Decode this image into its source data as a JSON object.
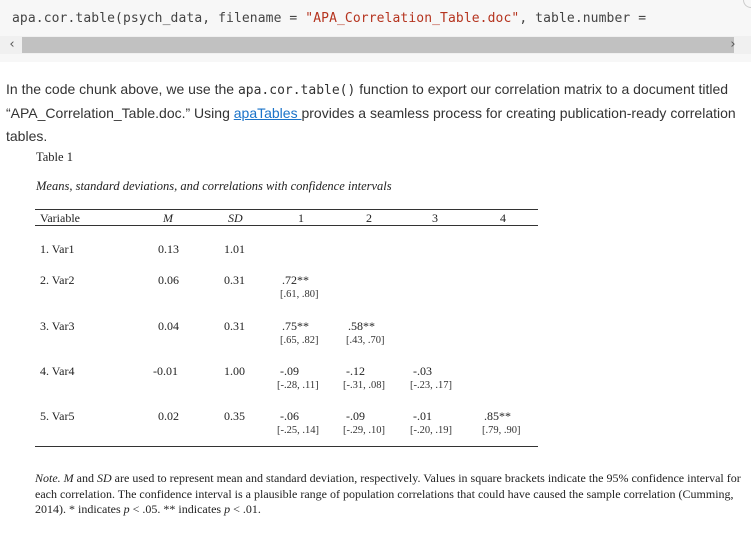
{
  "code": {
    "fn_part": "apa.cor.table(psych_data, filename = ",
    "string_part": "\"APA_Correlation_Table.doc\"",
    "rest_part": ", table.number ="
  },
  "scroll": {
    "left_arrow": "‹",
    "right_arrow": "›"
  },
  "paragraph": {
    "line1_before": "In the code chunk above, we use the ",
    "line1_code": "apa.cor.table()",
    "line1_after": " function to export our correlation matrix to a document titled",
    "line2_before": "“APA_Correlation_Table.doc.” Using ",
    "link_text": "apaTables ",
    "line2_after": "provides a seamless process for creating publication-ready correlation tables."
  },
  "apa_table": {
    "table_number": "Table 1",
    "title": "Means, standard deviations, and correlations with confidence intervals",
    "headers": [
      "Variable",
      "M",
      "SD",
      "1",
      "2",
      "3",
      "4"
    ],
    "rows": [
      {
        "variable": "1. Var1",
        "m": "0.13",
        "sd": "1.01",
        "corr": []
      },
      {
        "variable": "2. Var2",
        "m": "0.06",
        "sd": "0.31",
        "corr": [
          {
            "r": ".72**",
            "ci": "[.61, .80]"
          }
        ]
      },
      {
        "variable": "3. Var3",
        "m": "0.04",
        "sd": "0.31",
        "corr": [
          {
            "r": ".75**",
            "ci": "[.65, .82]"
          },
          {
            "r": ".58**",
            "ci": "[.43, .70]"
          }
        ]
      },
      {
        "variable": "4. Var4",
        "m": "-0.01",
        "sd": "1.00",
        "corr": [
          {
            "r": "-.09",
            "ci": "[-.28, .11]"
          },
          {
            "r": "-.12",
            "ci": "[-.31, .08]"
          },
          {
            "r": "-.03",
            "ci": "[-.23, .17]"
          }
        ]
      },
      {
        "variable": "5. Var5",
        "m": "0.02",
        "sd": "0.35",
        "corr": [
          {
            "r": "-.06",
            "ci": "[-.25, .14]"
          },
          {
            "r": "-.09",
            "ci": "[-.29, .10]"
          },
          {
            "r": "-.01",
            "ci": "[-.20, .19]"
          },
          {
            "r": ".85**",
            "ci": "[.79, .90]"
          }
        ]
      }
    ],
    "note": {
      "label": "Note.",
      "m": "M",
      "and": " and ",
      "sd": "SD",
      "text1": " are used to represent mean and standard deviation, respectively. Values in square brackets indicate the 95% confidence interval for each correlation. The confidence interval is a plausible range of population correlations that could have caused the sample correlation (Cumming, 2014). * indicates ",
      "p1": "p",
      "text2": " < .05. ** indicates ",
      "p2": "p",
      "text3": " < .01."
    }
  }
}
